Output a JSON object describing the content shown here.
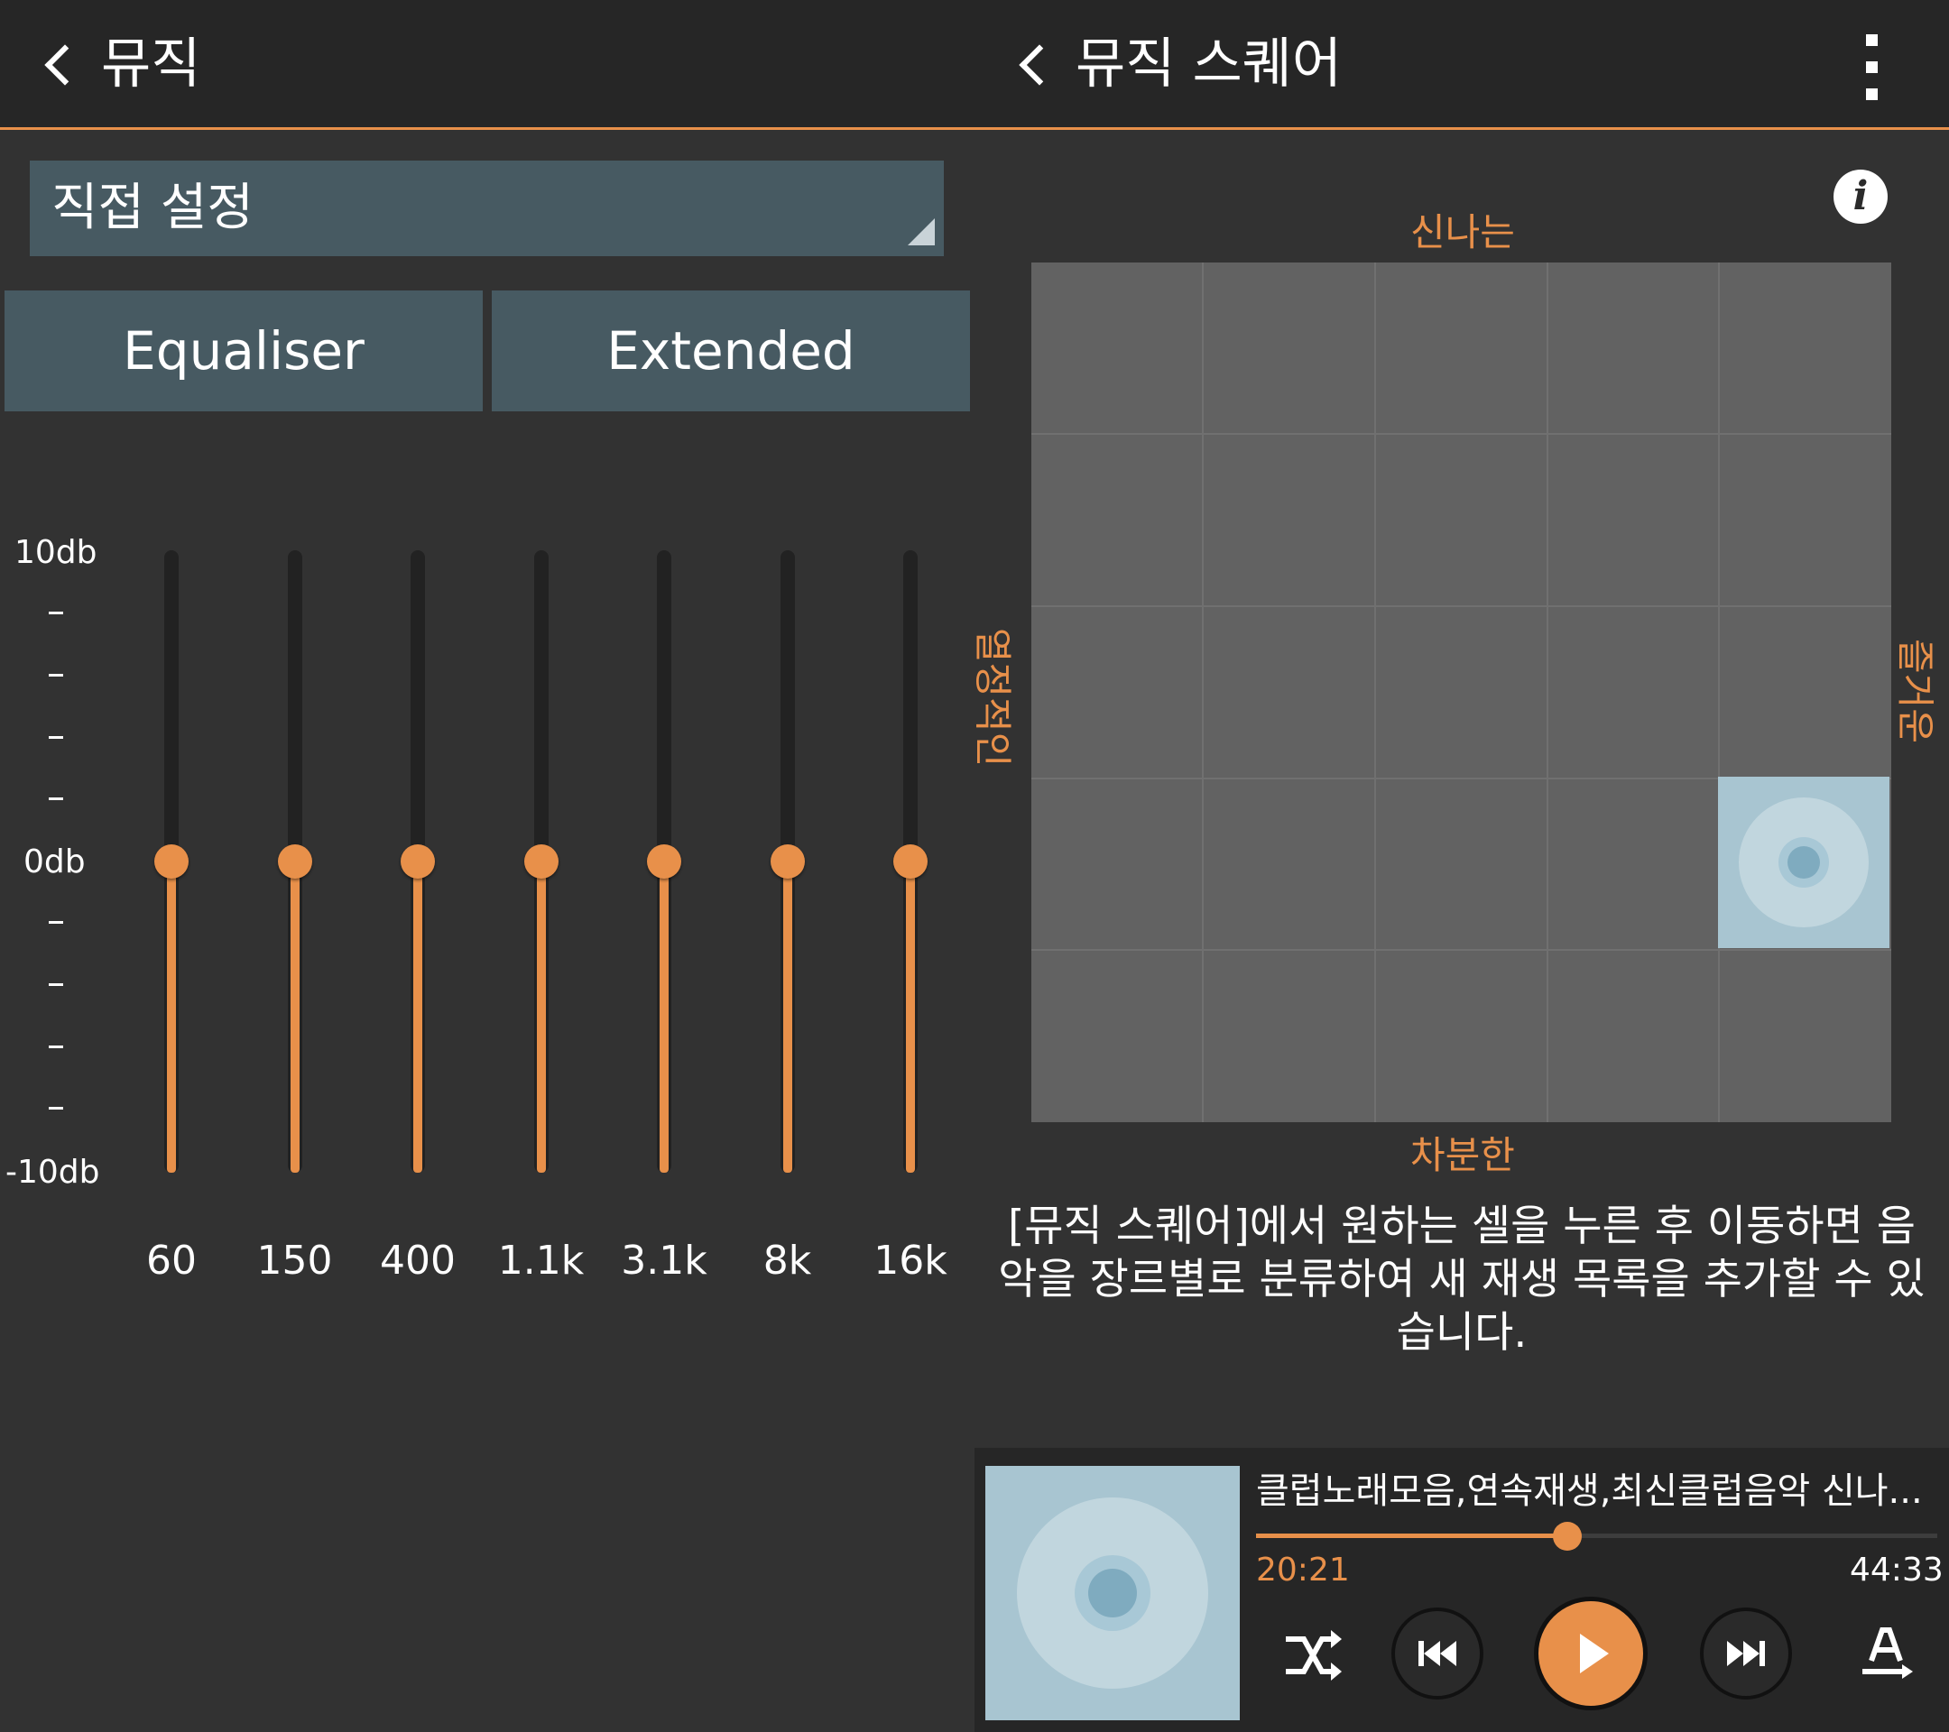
{
  "left_header": {
    "title": "뮤직"
  },
  "right_header": {
    "title": "뮤직 스퀘어"
  },
  "equalizer": {
    "preset": "직접 설정",
    "tabs": [
      "Equaliser",
      "Extended"
    ],
    "db_max_label": "10db",
    "db_mid_label": "0db",
    "db_min_label": "-10db",
    "db_range": [
      -10,
      10
    ],
    "bands": [
      {
        "freq": "60",
        "db": 0
      },
      {
        "freq": "150",
        "db": 0
      },
      {
        "freq": "400",
        "db": 0
      },
      {
        "freq": "1.1k",
        "db": 0
      },
      {
        "freq": "3.1k",
        "db": 0
      },
      {
        "freq": "8k",
        "db": 0
      },
      {
        "freq": "16k",
        "db": 0
      }
    ]
  },
  "music_square": {
    "label_top": "신나는",
    "label_bottom": "차분한",
    "label_left": "열정적인",
    "label_right": "즐거운",
    "grid_size": 5,
    "selected_cell": {
      "row": 3,
      "col": 4
    },
    "description": "[뮤직 스퀘어]에서 원하는 셀을 누른 후 이동하면 음악을 장르별로 분류하여 새 재생 목록을 추가할 수 있습니다."
  },
  "player": {
    "track_title": "클럽노래모음,연속재생,최신클럽음악 신나...",
    "elapsed": "20:21",
    "duration": "44:33",
    "progress_fraction": 0.457,
    "buttons": {
      "shuffle": "shuffle-icon",
      "previous": "previous-icon",
      "play": "play-icon",
      "next": "next-icon",
      "lyrics": "lyrics-icon"
    }
  },
  "colors": {
    "accent": "#e8904a",
    "panel": "#475a62",
    "cell": "#626262",
    "selected_cell": "#a8c5d1"
  }
}
